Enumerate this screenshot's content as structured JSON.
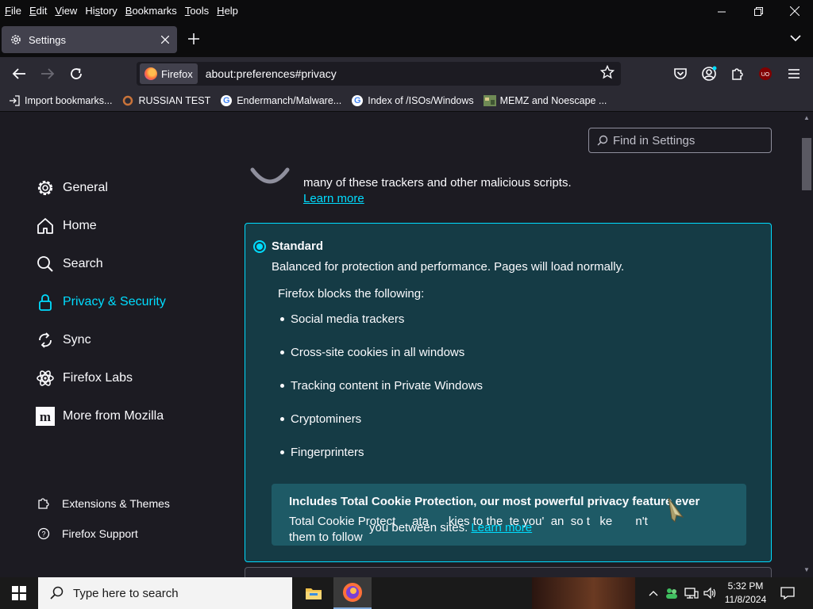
{
  "menubar": {
    "items": [
      "File",
      "Edit",
      "View",
      "History",
      "Bookmarks",
      "Tools",
      "Help"
    ],
    "underline": [
      "F",
      "E",
      "V",
      "s",
      "B",
      "T",
      "H"
    ]
  },
  "tab": {
    "title": "Settings"
  },
  "urlbar": {
    "identity": "Firefox",
    "url": "about:preferences#privacy"
  },
  "bookmarks": [
    {
      "label": "Import bookmarks...",
      "icon": "import-icon"
    },
    {
      "label": "RUSSIAN TEST",
      "icon": "ring-icon"
    },
    {
      "label": "Endermanch/Malware...",
      "icon": "google-icon"
    },
    {
      "label": "Index of /ISOs/Windows",
      "icon": "google-icon"
    },
    {
      "label": "MEMZ and Noescape ...",
      "icon": "image-icon"
    }
  ],
  "find": {
    "placeholder": "Find in Settings"
  },
  "sidebar": {
    "items": [
      {
        "label": "General",
        "icon": "gear-icon"
      },
      {
        "label": "Home",
        "icon": "home-icon"
      },
      {
        "label": "Search",
        "icon": "search-icon"
      },
      {
        "label": "Privacy & Security",
        "icon": "lock-icon",
        "active": true
      },
      {
        "label": "Sync",
        "icon": "sync-icon"
      },
      {
        "label": "Firefox Labs",
        "icon": "labs-icon"
      },
      {
        "label": "More from Mozilla",
        "icon": "mozilla-icon"
      }
    ],
    "footer": [
      {
        "label": "Extensions & Themes",
        "icon": "puzzle-icon"
      },
      {
        "label": "Firefox Support",
        "icon": "help-icon"
      }
    ]
  },
  "privacy": {
    "partial_text": "many of these trackers and other malicious scripts.",
    "learn_more": "Learn more",
    "standard": {
      "title": "Standard",
      "desc": "Balanced for protection and performance. Pages will load normally.",
      "blocks_heading": "Firefox blocks the following:",
      "blocks": [
        "Social media trackers",
        "Cross-site cookies in all windows",
        "Tracking content in Private Windows",
        "Cryptominers",
        "Fingerprinters"
      ],
      "tcp_title": "Includes Total Cookie Protection, our most powerful privacy feature ever",
      "tcp_line1": "Total Cookie Protect     ata      kies to the  te you'  an  so t   ke       n't",
      "tcp_line2": "them to follow",
      "tcp_overlap": "you between sites.",
      "tcp_link": "Learn more"
    }
  },
  "taskbar": {
    "search_placeholder": "Type here to search",
    "time": "5:32 PM",
    "date": "11/8/2024"
  },
  "colors": {
    "accent": "#00ddff",
    "box_bg": "#153b45",
    "tcp_bg": "#1e5a66"
  }
}
